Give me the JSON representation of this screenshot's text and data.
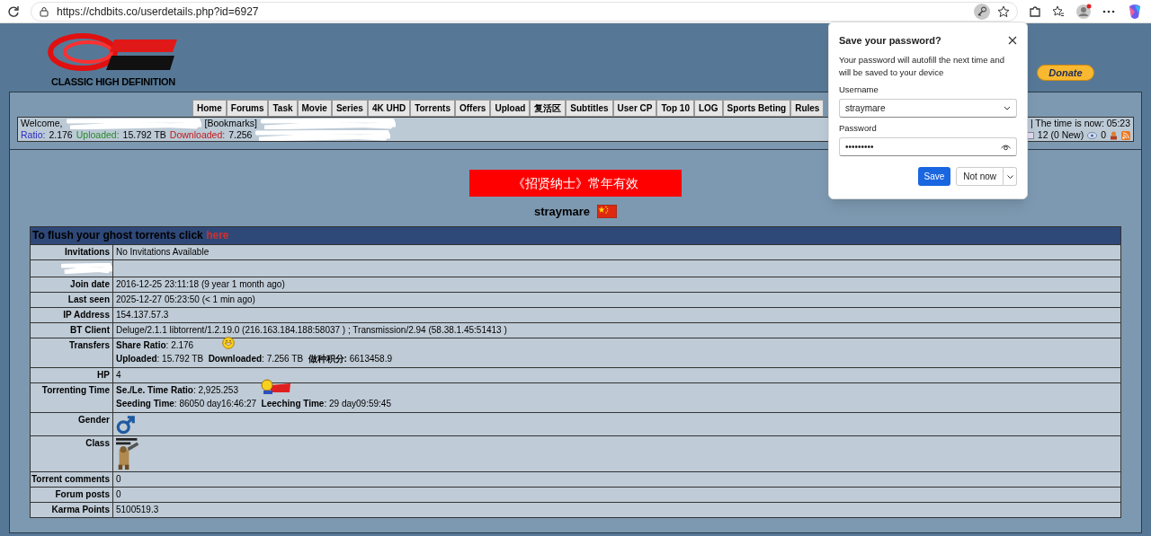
{
  "browser": {
    "url": "https://chdbits.co/userdetails.php?id=6927"
  },
  "site": {
    "logo_tagline": "CLASSIC HIGH DEFINITION",
    "donate": "Donate"
  },
  "nav": [
    {
      "label": "Home"
    },
    {
      "label": "Forums"
    },
    {
      "label": "Task"
    },
    {
      "label": "Movie"
    },
    {
      "label": "Series"
    },
    {
      "label": "4K UHD"
    },
    {
      "label": "Torrents"
    },
    {
      "label": "Offers"
    },
    {
      "label": "Upload"
    },
    {
      "label": "复活区"
    },
    {
      "label": "Subtitles"
    },
    {
      "label": "User CP"
    },
    {
      "label": "Top 10"
    },
    {
      "label": "LOG"
    },
    {
      "label": "Sports Beting"
    },
    {
      "label": "Rules"
    }
  ],
  "user_bar": {
    "line1": [
      {
        "text": "Welcome,",
        "kind": "plain"
      },
      {
        "kind": "redacted"
      },
      {
        "text": "[Bookmarks]",
        "kind": "plain"
      },
      {
        "kind": "redacted"
      }
    ],
    "line2": [
      {
        "text": "Ratio:",
        "kind": "label",
        "color": "#2a2ac0"
      },
      {
        "text": "2.176",
        "kind": "plain"
      },
      {
        "text": "Uploaded:",
        "kind": "label",
        "color": "#2a8a2a"
      },
      {
        "text": "15.792 TB",
        "kind": "plain"
      },
      {
        "text": "Downloaded:",
        "kind": "label",
        "color": "#c01818"
      },
      {
        "text": "7.256",
        "kind": "plain"
      },
      {
        "kind": "redacted"
      }
    ],
    "time": "| The time is now: 05:23",
    "messages": "12 (0 New)",
    "watch_count": "0"
  },
  "banner": "《招贤纳士》常年有效",
  "profile": {
    "username": "straymare"
  },
  "table": {
    "header": "To flush your ghost torrents click",
    "header_link": "here",
    "rows": [
      {
        "kind": "text",
        "label": "Invitations",
        "lines": [
          "No Invitations Available"
        ]
      },
      {
        "kind": "redacted"
      },
      {
        "kind": "text",
        "label": "Join date",
        "lines": [
          "2016-12-25 23:11:18 (9 year 1 month ago)"
        ]
      },
      {
        "kind": "text",
        "label": "Last seen",
        "lines": [
          "2025-12-27 05:23:50 (< 1 min ago)"
        ]
      },
      {
        "kind": "text",
        "label": "IP Address",
        "lines": [
          "154.137.57.3"
        ]
      },
      {
        "kind": "text",
        "label": "BT Client",
        "lines": [
          "Deluge/2.1.1 libtorrent/1.2.19.0 (216.163.184.188:58037 ) ; Transmission/2.94 (58.38.1.45:51413 )"
        ]
      },
      {
        "kind": "transfers",
        "label": "Transfers",
        "lines": [
          "**Share Ratio**: 2.176",
          "**Uploaded**: 15.792 TB  **Downloaded**: 7.256 TB  **做种积分:** 6613458.9"
        ]
      },
      {
        "kind": "text",
        "label": "HP",
        "lines": [
          "4"
        ]
      },
      {
        "kind": "time",
        "label": "Torrenting Time",
        "lines": [
          "**Se./Le. Time Ratio**: 2,925.253",
          "**Seeding Time**: 86050 day16:46:27  **Leeching Time**: 29 day09:59:45"
        ]
      },
      {
        "kind": "gender",
        "label": "Gender"
      },
      {
        "kind": "class",
        "label": "Class"
      },
      {
        "kind": "text",
        "label": "Torrent comments",
        "lines": [
          "0"
        ]
      },
      {
        "kind": "text",
        "label": "Forum posts",
        "lines": [
          "0"
        ]
      },
      {
        "kind": "text",
        "label": "Karma Points",
        "lines": [
          "5100519.3"
        ]
      }
    ]
  },
  "popup": {
    "title": "Save your password?",
    "description": "Your password will autofill the next time and will be saved to your device",
    "username_label": "Username",
    "username": "straymare",
    "password_label": "Password",
    "password": "•••••••••",
    "save": "Save",
    "not_now": "Not now"
  }
}
